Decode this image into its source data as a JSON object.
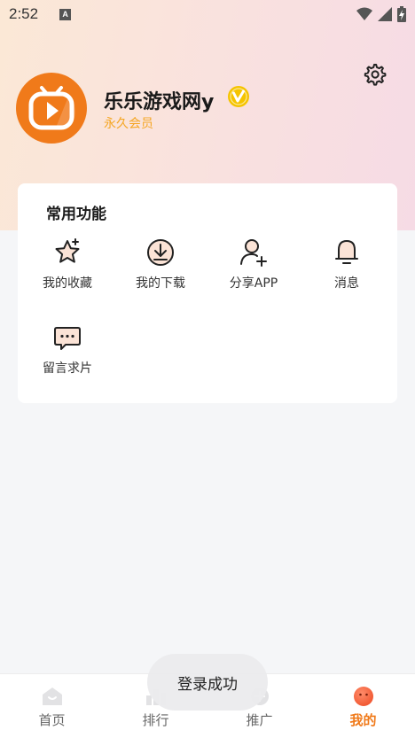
{
  "status_bar": {
    "time": "2:52",
    "notif_letter": "A"
  },
  "profile": {
    "username": "乐乐游戏网y",
    "membership": "永久会员"
  },
  "functions": {
    "title": "常用功能",
    "items": [
      {
        "label": "我的收藏",
        "icon": "star-icon"
      },
      {
        "label": "我的下载",
        "icon": "download-icon"
      },
      {
        "label": "分享APP",
        "icon": "add-user-icon"
      },
      {
        "label": "消息",
        "icon": "bell-icon"
      },
      {
        "label": "留言求片",
        "icon": "message-icon"
      }
    ]
  },
  "tabs": [
    {
      "label": "首页",
      "icon": "home-icon"
    },
    {
      "label": "排行",
      "icon": "ranking-icon"
    },
    {
      "label": "推广",
      "icon": "promote-icon"
    },
    {
      "label": "我的",
      "icon": "profile-icon",
      "active": true
    }
  ],
  "toast": "登录成功",
  "colors": {
    "accent": "#f07a1a",
    "vip": "#f5c400",
    "member": "#f5a623"
  }
}
